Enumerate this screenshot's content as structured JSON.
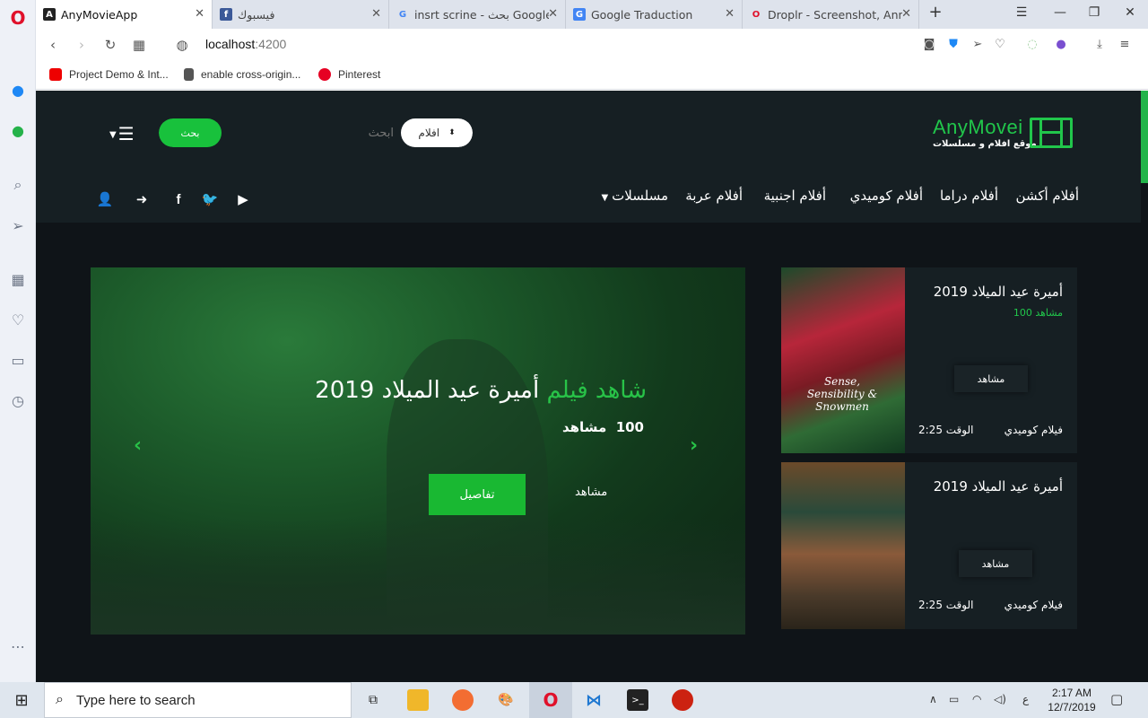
{
  "browser": {
    "tabs": [
      {
        "title": "AnyMovieApp",
        "active": true,
        "icon": "angular-icon"
      },
      {
        "title": "فيسبوك",
        "active": false,
        "icon": "facebook-icon"
      },
      {
        "title": "insrt scrine - بحث Google",
        "active": false,
        "icon": "google-icon"
      },
      {
        "title": "Google Traduction",
        "active": false,
        "icon": "translate-icon"
      },
      {
        "title": "Droplr - Screenshot, Annot",
        "active": false,
        "icon": "opera-icon"
      }
    ],
    "url_host": "localhost",
    "url_port": ":4200",
    "bookmarks": [
      {
        "label": "Project Demo & Int...",
        "icon": "youtube-icon"
      },
      {
        "label": "enable cross-origin...",
        "icon": "file-icon"
      },
      {
        "label": "Pinterest",
        "icon": "pinterest-icon"
      }
    ]
  },
  "site": {
    "logo": {
      "name": "AnyMovei",
      "subtitle": "موقع افلام و مسلسلات"
    },
    "search": {
      "button": "بحث",
      "placeholder": "ابحث",
      "category": "افلام"
    },
    "nav": [
      "أفلام أكشن",
      "أفلام دراما",
      "أفلام كوميدي",
      "أفلام اجنبية",
      "أفلام عربة",
      "مسلسلات"
    ],
    "hero": {
      "prefix": "شاهد فيلم",
      "title": "أميرة عيد الميلاد 2019",
      "views_count": "100",
      "views_label": "مشاهد",
      "details_button": "تفاصيل",
      "watch_label": "مشاهد"
    },
    "cards": [
      {
        "title": "أميرة عيد الميلاد 2019",
        "views": "مشاهد 100",
        "watch": "مشاهد",
        "genre": "فيلام كوميدي",
        "time": "الوقت 2:25",
        "poster_text": "Sense, Sensibility & Snowmen"
      },
      {
        "title": "أميرة عيد الميلاد 2019",
        "views": "",
        "watch": "مشاهد",
        "genre": "فيلام كوميدي",
        "time": "الوقت 2:25",
        "poster_text": ""
      }
    ]
  },
  "taskbar": {
    "search_placeholder": "Type here to search",
    "time": "2:17 AM",
    "date": "12/7/2019",
    "lang": "ع"
  },
  "colors": {
    "accent": "#21c64b",
    "header_bg": "#161f23",
    "page_bg": "#0f1418"
  }
}
